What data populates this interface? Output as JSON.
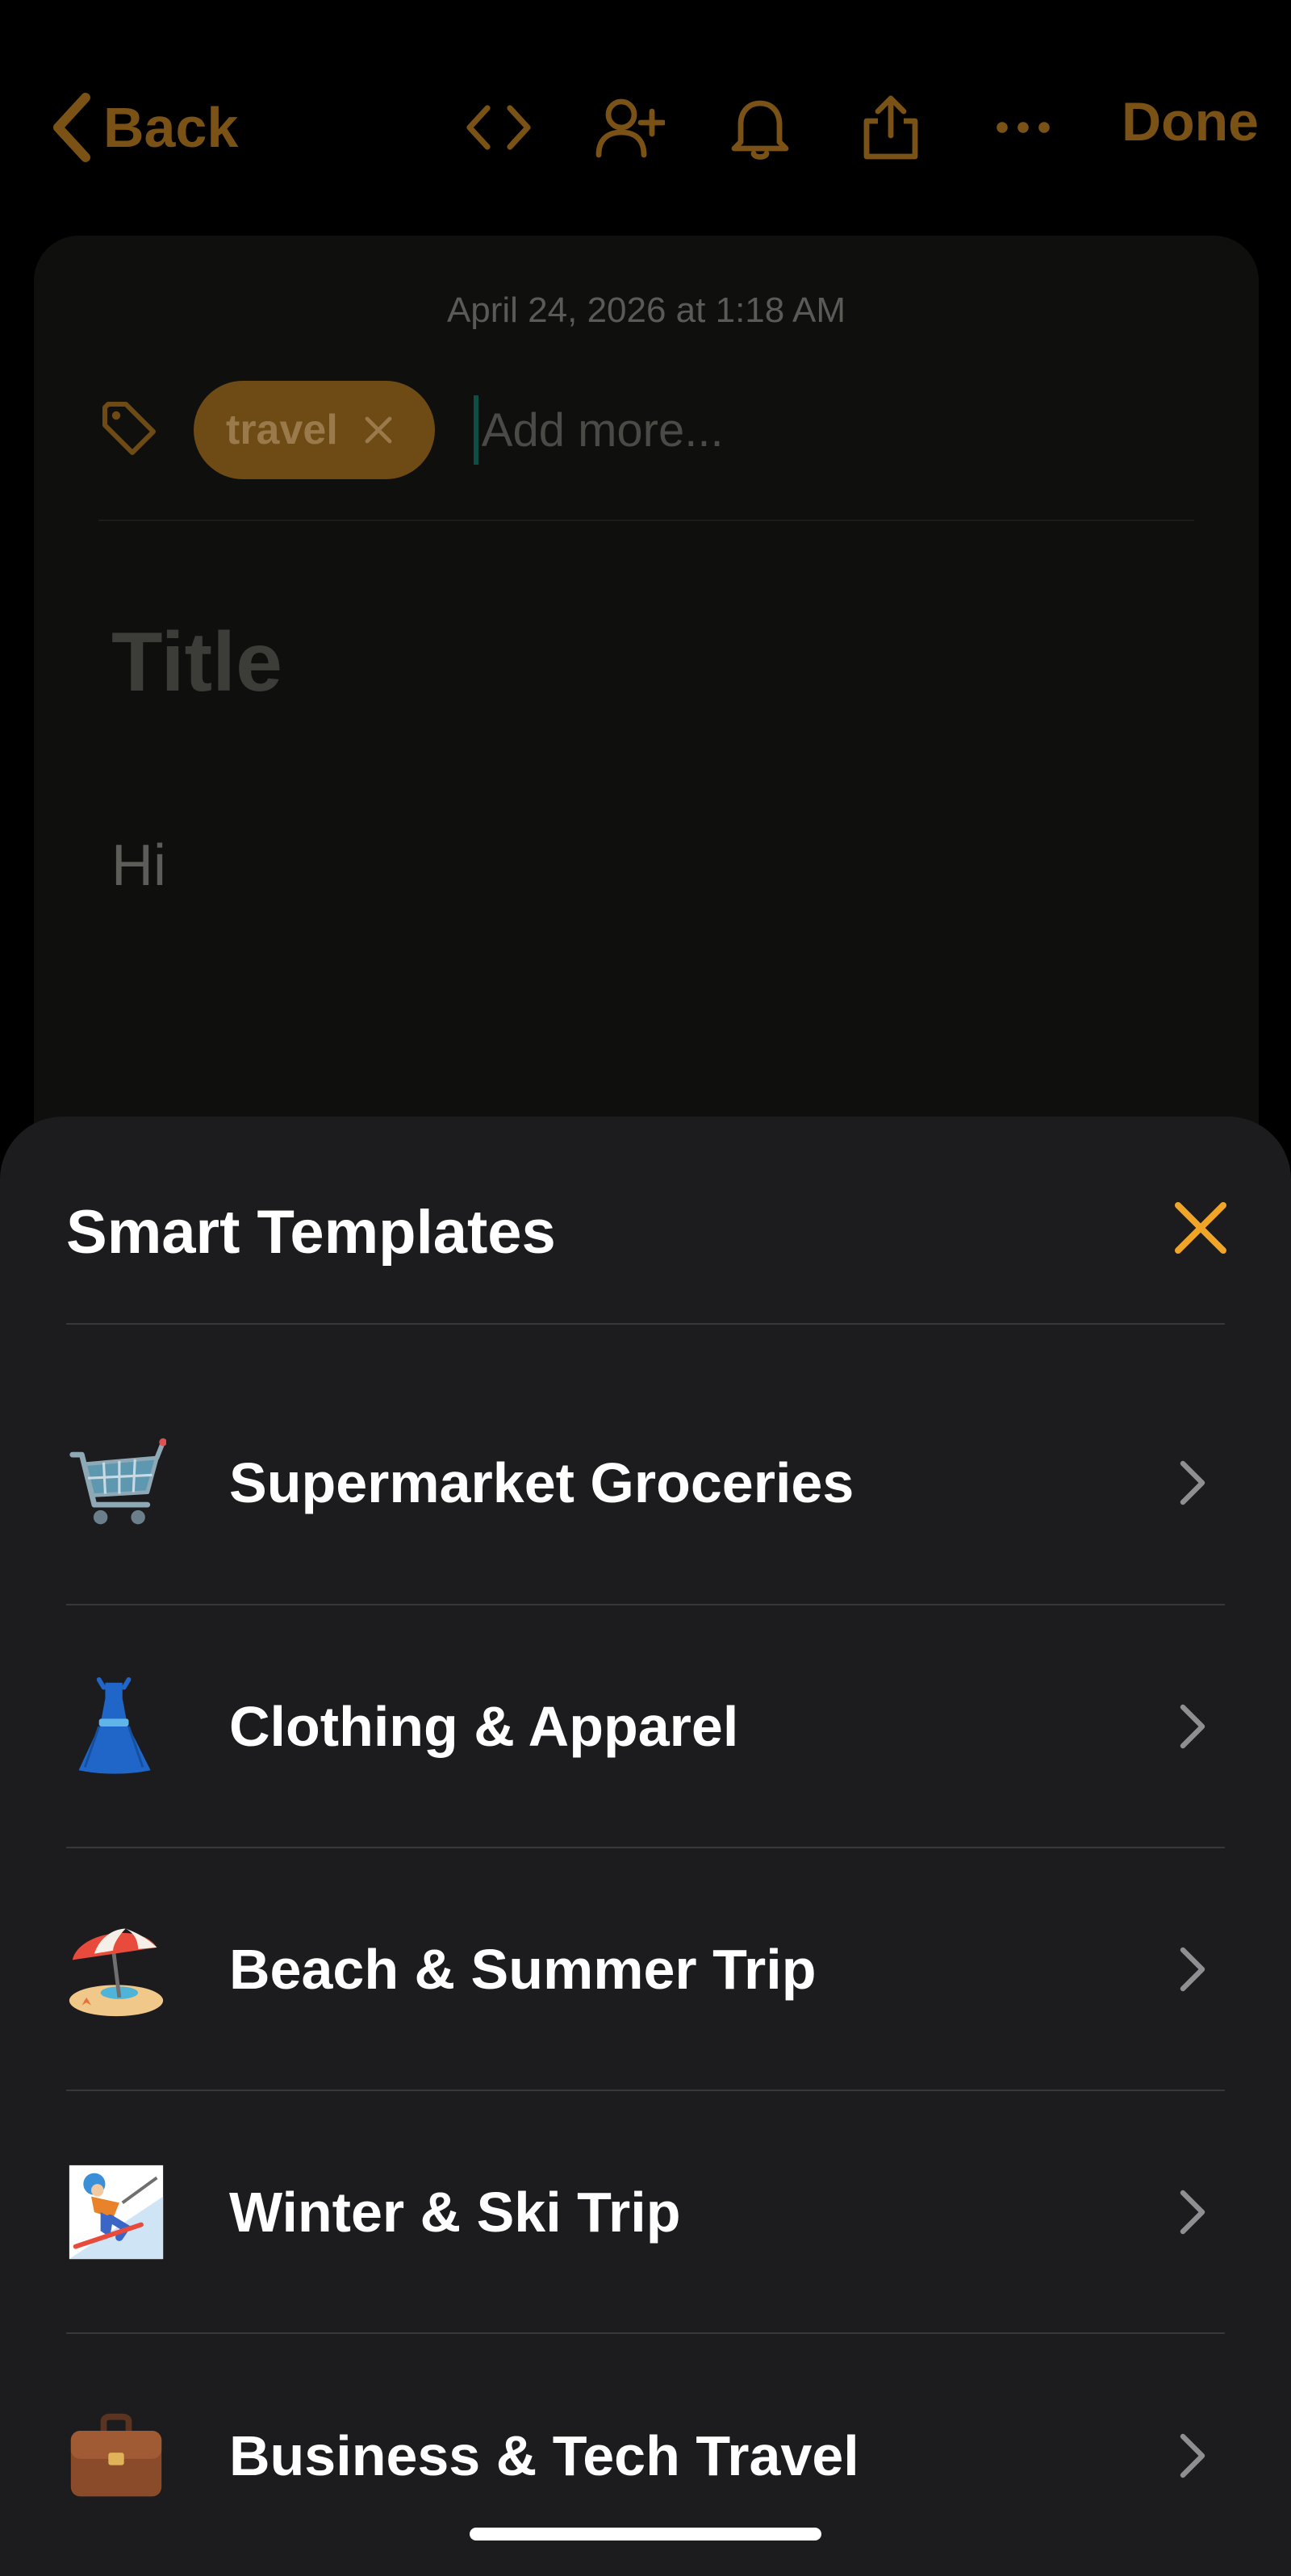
{
  "nav": {
    "back_label": "Back",
    "done_label": "Done",
    "icons": [
      "code-icon",
      "add-collaborator-icon",
      "bell-icon",
      "share-icon",
      "more-icon"
    ]
  },
  "note": {
    "date": "April 24, 2026 at 1:18 AM",
    "tag": "travel",
    "tag_input_placeholder": "Add more...",
    "title_placeholder": "Title",
    "body": "Hi"
  },
  "sheet": {
    "title": "Smart Templates",
    "templates": [
      {
        "label": "Supermarket Groceries",
        "icon": "shopping-cart-icon"
      },
      {
        "label": "Clothing & Apparel",
        "icon": "dress-icon"
      },
      {
        "label": "Beach & Summer Trip",
        "icon": "beach-umbrella-icon"
      },
      {
        "label": "Winter & Ski Trip",
        "icon": "skier-icon"
      },
      {
        "label": "Business & Tech Travel",
        "icon": "briefcase-icon"
      }
    ]
  },
  "colors": {
    "accent": "#f0a526",
    "accent_dimmed": "#7a5216",
    "sheet_background": "#1c1c1e",
    "divider": "#38383a"
  }
}
